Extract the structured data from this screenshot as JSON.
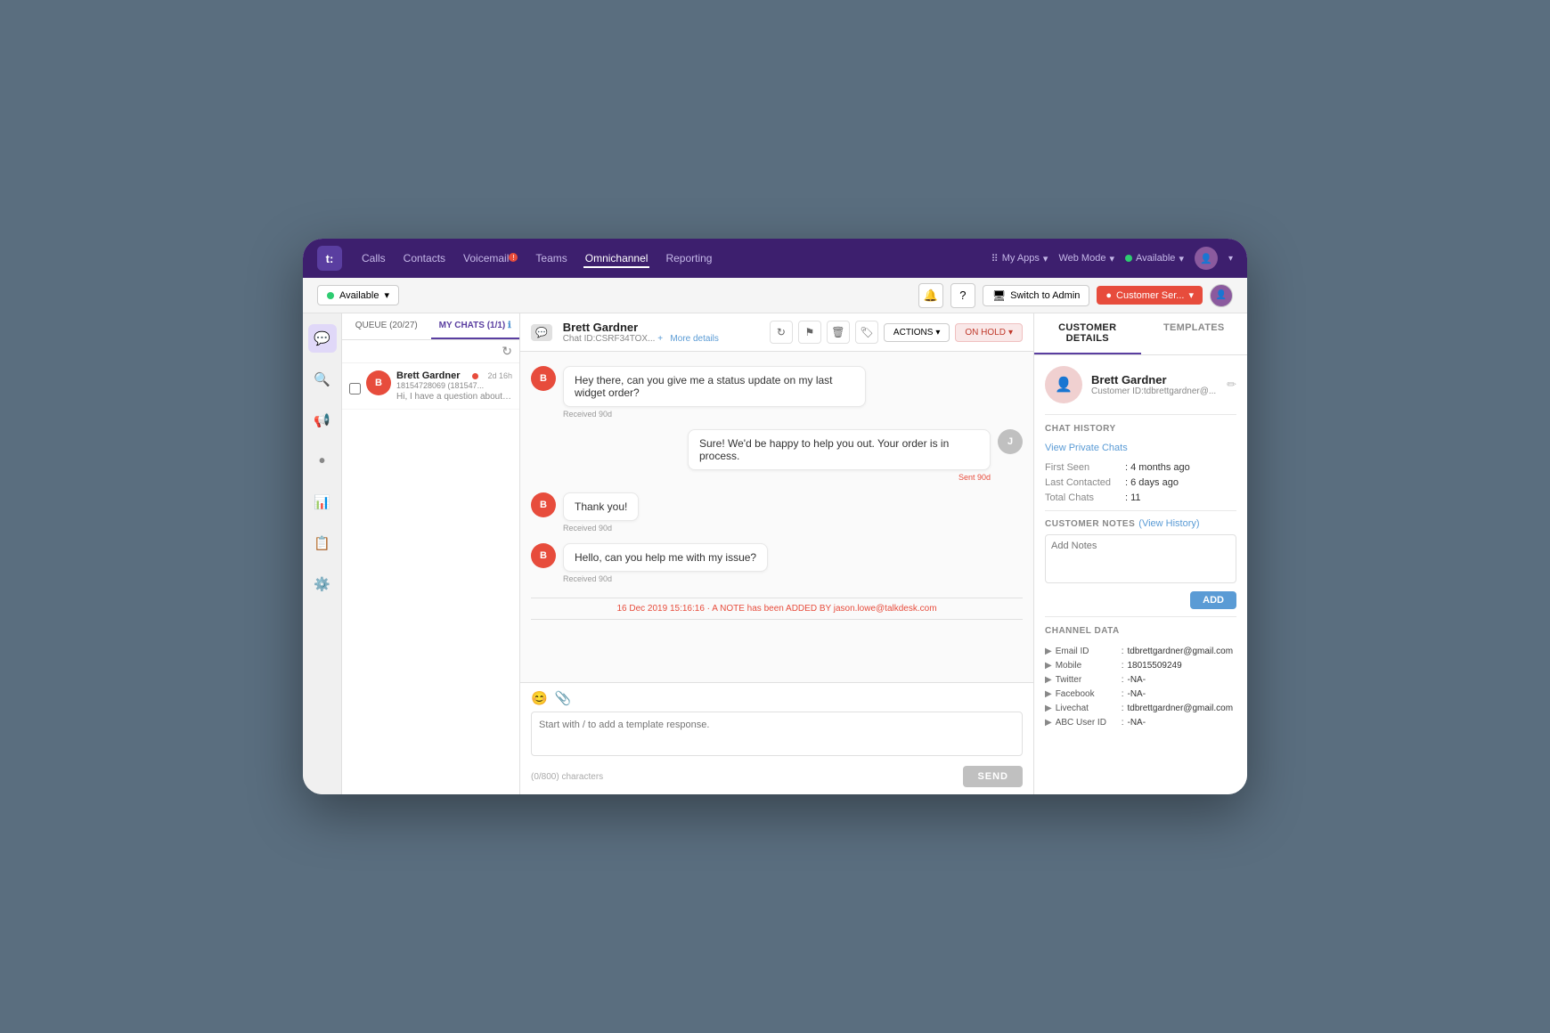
{
  "nav": {
    "logo": "t:",
    "links": [
      {
        "label": "Calls",
        "active": false
      },
      {
        "label": "Contacts",
        "active": false
      },
      {
        "label": "Voicemail",
        "active": false,
        "badge": true
      },
      {
        "label": "Teams",
        "active": false
      },
      {
        "label": "Omnichannel",
        "active": true
      },
      {
        "label": "Reporting",
        "active": false
      }
    ],
    "right": {
      "apps_label": "My Apps",
      "web_mode_label": "Web Mode",
      "available_label": "Available",
      "available_dot": true
    }
  },
  "sub_nav": {
    "status": "Available",
    "switch_to_admin": "Switch to Admin",
    "customer_ser": "Customer Ser..."
  },
  "sidebar": {
    "icons": [
      {
        "name": "chat-icon",
        "symbol": "💬",
        "active": true
      },
      {
        "name": "search-icon",
        "symbol": "🔍",
        "active": false
      },
      {
        "name": "megaphone-icon",
        "symbol": "📢",
        "active": false
      },
      {
        "name": "dot-icon",
        "symbol": "•",
        "active": false
      },
      {
        "name": "bar-chart-icon",
        "symbol": "📊",
        "active": false
      },
      {
        "name": "clipboard-icon",
        "symbol": "📋",
        "active": false
      },
      {
        "name": "gear-icon",
        "symbol": "⚙️",
        "active": false
      }
    ]
  },
  "chat_list": {
    "queue_tab": "QUEUE (20/27)",
    "my_chats_tab": "MY CHATS (1/1)",
    "my_chats_help": "ℹ",
    "items": [
      {
        "name": "Brett Gardner",
        "online": true,
        "id": "18154728069 (181547...",
        "time": "2d 16h",
        "preview": "Hi, I have a question about residential service."
      }
    ]
  },
  "chat": {
    "contact_name": "Brett Gardner",
    "chat_id": "Chat ID:CSRF34TOX...",
    "more_details": "More details",
    "actions_label": "ACTIONS",
    "on_hold_label": "ON HOLD",
    "messages": [
      {
        "type": "received",
        "sender": "B",
        "text": "Hey there, can you give me a status update on my last widget order?",
        "meta": "Received 90d"
      },
      {
        "type": "sent",
        "sender": "J",
        "text": "Sure! We'd be happy to help you out. Your order is in process.",
        "meta": "Sent 90d"
      },
      {
        "type": "received",
        "sender": "B",
        "text": "Thank you!",
        "meta": "Received 90d"
      },
      {
        "type": "received",
        "sender": "B",
        "text": "Hello, can you help me with my issue?",
        "meta": "Received 90d"
      }
    ],
    "note_divider": "16 Dec 2019 15:16:16 · A NOTE has been ADDED BY jason.lowe@talkdesk.com",
    "input_placeholder": "Start with / to add a template response.",
    "char_count": "(0/800) characters",
    "send_label": "SEND"
  },
  "right_panel": {
    "tabs": [
      {
        "label": "CUSTOMER DETAILS",
        "active": true
      },
      {
        "label": "TEMPLATES",
        "active": false
      }
    ],
    "customer": {
      "name": "Brett Gardner",
      "customer_id": "Customer ID:tdbrettgardner@..."
    },
    "chat_history": {
      "section_title": "CHAT HISTORY",
      "view_link": "View Private Chats",
      "first_seen_label": "First Seen",
      "first_seen_value": ": 4 months ago",
      "last_contacted_label": "Last Contacted",
      "last_contacted_value": ": 6 days ago",
      "total_chats_label": "Total Chats",
      "total_chats_value": ": 11"
    },
    "customer_notes": {
      "section_title": "CUSTOMER NOTES",
      "view_history": "(View History)",
      "add_placeholder": "Add Notes",
      "add_btn": "ADD"
    },
    "channel_data": {
      "section_title": "CHANNEL DATA",
      "items": [
        {
          "label": "Email ID",
          "value": "tdbrettgardner@gmail.com"
        },
        {
          "label": "Mobile",
          "value": "18015509249"
        },
        {
          "label": "Twitter",
          "value": "-NA-"
        },
        {
          "label": "Facebook",
          "value": "-NA-"
        },
        {
          "label": "Livechat",
          "value": "tdbrettgardner@gmail.com"
        },
        {
          "label": "ABC User ID",
          "value": "-NA-"
        }
      ]
    }
  }
}
